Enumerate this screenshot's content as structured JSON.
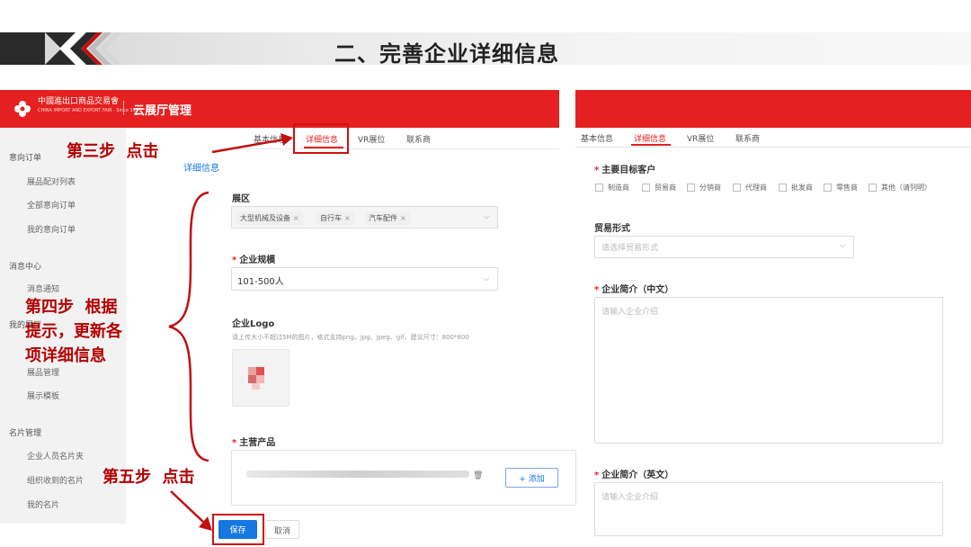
{
  "title": "二、完善企业详细信息",
  "header": {
    "logo_text": "中國進出口商品交易會",
    "logo_sub": "CHINA IMPORT AND EXPORT FAIR · Since 1957",
    "app_name": "云展厅管理"
  },
  "sidebar": {
    "groups": [
      {
        "label": "意向订单",
        "items": [
          "展品配对列表",
          "全部意向订单",
          "我的意向订单"
        ]
      },
      {
        "label": "消息中心",
        "items": [
          "消息通知"
        ]
      },
      {
        "label": "我的展厅",
        "items": [
          "展品管理",
          "展示模板"
        ]
      },
      {
        "label": "名片管理",
        "items": [
          "企业人员名片夹",
          "组织收到的名片",
          "我的名片"
        ]
      }
    ]
  },
  "tabs": [
    "基本信息",
    "详细信息",
    "VR展位",
    "联系商"
  ],
  "section_title": "详细信息",
  "left_form": {
    "zone_label": "展区",
    "zone_tags": [
      "大型机械及设备",
      "自行车",
      "汽车配件"
    ],
    "scale_label": "企业规模",
    "scale_value": "101-500人",
    "logo_label": "企业Logo",
    "logo_hint": "请上传大小不超过5M的图片，格式支持png、jpg、jpeg、gif，建议尺寸：800*800",
    "product_label": "主营产品",
    "add_button": "+ 添加",
    "save_button": "保存",
    "cancel_button": "取消"
  },
  "right_form": {
    "customers_label": "主要目标客户",
    "customer_options": [
      "制造商",
      "贸易商",
      "分销商",
      "代理商",
      "批发商",
      "零售商",
      "其他（请列明）"
    ],
    "trade_label": "贸易形式",
    "trade_placeholder": "请选择贸易形式",
    "intro_cn_label": "企业简介（中文）",
    "intro_cn_placeholder": "请输入企业介绍",
    "intro_en_label": "企业简介（英文）",
    "intro_en_placeholder": "请输入企业介绍"
  },
  "annotations": {
    "step3": "第三步  点击",
    "step4_line1": "第四步  根据",
    "step4_line2": "提示，更新各",
    "step4_line3": "项详细信息",
    "step5": "第五步  点击"
  },
  "colors": {
    "brand_red": "#e52020",
    "annotation_red": "#b30000",
    "primary_blue": "#1677e0"
  }
}
